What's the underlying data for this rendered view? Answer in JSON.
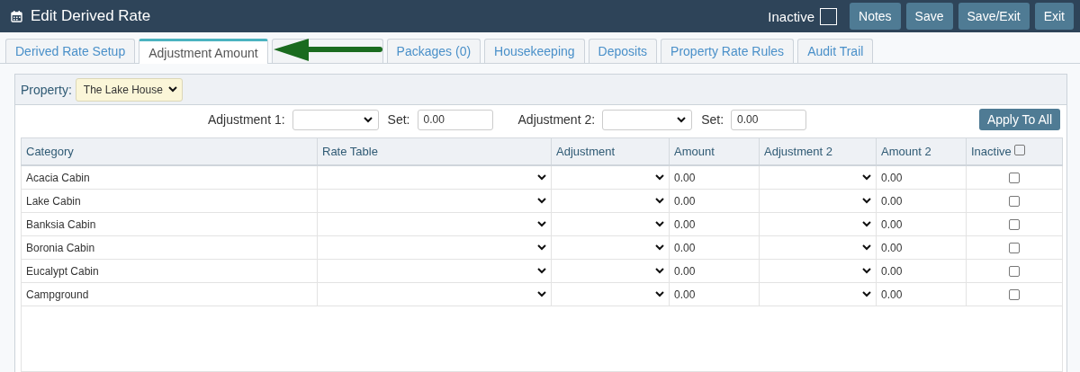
{
  "window": {
    "title": "Edit Derived Rate",
    "inactive_label": "Inactive",
    "inactive_checked": false,
    "buttons": [
      "Notes",
      "Save",
      "Save/Exit",
      "Exit"
    ]
  },
  "tabs": [
    {
      "label": "Derived Rate Setup",
      "selected": false
    },
    {
      "label": "Adjustment Amount",
      "selected": true
    },
    {
      "selected": false
    },
    {
      "label": "Packages (0)",
      "selected": false
    },
    {
      "label": "Housekeeping",
      "selected": false
    },
    {
      "label": "Deposits",
      "selected": false
    },
    {
      "label": "Property Rate Rules",
      "selected": false
    },
    {
      "label": "Audit Trail",
      "selected": false
    }
  ],
  "property": {
    "label": "Property:",
    "value": "The Lake House"
  },
  "bulk": {
    "adjustment1_label": "Adjustment 1:",
    "set1_label": "Set:",
    "set1_value": "0.00",
    "adjustment2_label": "Adjustment 2:",
    "set2_label": "Set:",
    "set2_value": "0.00",
    "apply_button": "Apply To All"
  },
  "table": {
    "columns": [
      "Category",
      "Rate Table",
      "Adjustment",
      "Amount",
      "Adjustment 2",
      "Amount 2",
      "Inactive"
    ],
    "inactive_all_checked": false,
    "rows": [
      {
        "category": "Acacia Cabin",
        "amount": "0.00",
        "amount2": "0.00",
        "inactive": false
      },
      {
        "category": "Lake Cabin",
        "amount": "0.00",
        "amount2": "0.00",
        "inactive": false
      },
      {
        "category": "Banksia Cabin",
        "amount": "0.00",
        "amount2": "0.00",
        "inactive": false
      },
      {
        "category": "Boronia Cabin",
        "amount": "0.00",
        "amount2": "0.00",
        "inactive": false
      },
      {
        "category": "Eucalypt Cabin",
        "amount": "0.00",
        "amount2": "0.00",
        "inactive": false
      },
      {
        "category": "Campground",
        "amount": "0.00",
        "amount2": "0.00",
        "inactive": false
      }
    ]
  }
}
